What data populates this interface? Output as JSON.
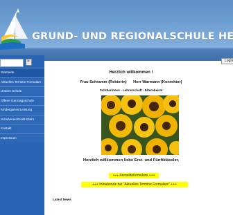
{
  "header": {
    "title": "GRUND- UND REGIONALSCHULE HEIKENDORF",
    "logo_icon": "sailboat-logo-icon"
  },
  "search": {
    "placeholder": "",
    "button_icon": "search-go-icon",
    "button_label": "»"
  },
  "sidebar": {
    "items": [
      {
        "label": "Startseite"
      },
      {
        "label": "Aktuelles Termine Formulare"
      },
      {
        "label": "Unsere Schule"
      },
      {
        "label": "Offene Ganztagsschule"
      },
      {
        "label": "Kindergarten/Leistung"
      },
      {
        "label": "Schulverein/Kraft Eltern"
      },
      {
        "label": "Kontakt"
      },
      {
        "label": "Impressum"
      }
    ]
  },
  "toolbar": {
    "login_label": "Login"
  },
  "content": {
    "welcome": "Herzlich willkommen !",
    "principal_1": "Frau Schramm (Rektorin)",
    "principal_2": "Herr Warmann (Konrektor)",
    "groups": "Schülerinnen - Lehrerschaft - Elternbeirat",
    "greeting": "Herzlich willkommen liebe Erst- und Fünftklässler.",
    "notice_1": "+++ Anmeldeformulare +++",
    "notice_2": "+++ Infoabende bei \"Aktuelles Termine Formulare\" +++",
    "latest_news": "Latest News"
  },
  "colors": {
    "header_blue": "#6d9dd0",
    "sidebar_blue": "#2a64b5",
    "highlight_yellow": "#ffff00"
  }
}
